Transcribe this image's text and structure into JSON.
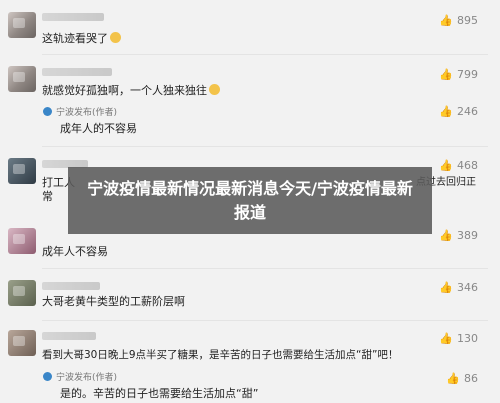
{
  "comments": [
    {
      "text": "这轨迹看哭了",
      "likes": "895"
    },
    {
      "text": "就感觉好孤独啊，一个人独来独往",
      "likes": "799",
      "reply": {
        "author": "宁波发布(作者)",
        "text": "成年人的不容易"
      }
    },
    {
      "likes": "246"
    },
    {
      "text_left": "打工人",
      "text_right": "点过去回归正",
      "text_line2": "常",
      "likes": "468"
    },
    {
      "text": "成年人不容易",
      "likes": "389"
    },
    {
      "text": "大哥老黄牛类型的工薪阶层啊",
      "likes": "346"
    },
    {
      "text": "看到大哥30日晚上9点半买了糖果，是辛苦的日子也需要给生活加点“甜”吧！",
      "likes": "130",
      "reply": {
        "author": "宁波发布(作者)",
        "text": "是的。辛苦的日子也需要给生活加点“甜”",
        "likes": "86"
      }
    }
  ],
  "overlay_title": "宁波疫情最新情况最新消息今天/宁波疫情最新报道",
  "icons": {
    "like": "thumbs-up-icon"
  },
  "colors": {
    "background": "#f2f2f2",
    "overlay": "#5a5a5a",
    "reply_avatar": "#3a86c8"
  }
}
